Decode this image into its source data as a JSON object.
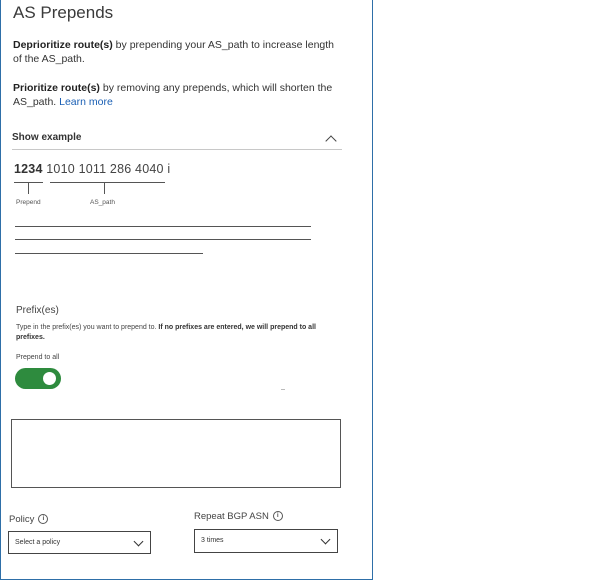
{
  "title": "AS Prepends",
  "deprioritize": {
    "strong": "Deprioritize route(s)",
    "text": " by prepending your AS_path to increase length of the AS_path."
  },
  "prioritize": {
    "strong": "Prioritize route(s)",
    "text": " by removing any prepends, which will shorten the AS_path. ",
    "link": "Learn more"
  },
  "example": {
    "toggle_label": "Show example",
    "prepend_value": "1234",
    "path_value": " 1010 1011 286 4040 i",
    "prepend_label": "Prepend",
    "aspath_label": "AS_path"
  },
  "prefixes": {
    "title": "Prefix(es)",
    "help_text": "Type in the prefix(es) you want to prepend to. ",
    "help_bold": "If no prefixes are entered, we will prepend to all prefixes.",
    "prepend_to_all_label": "Prepend to all",
    "prepend_to_all_on": true,
    "input_value": ""
  },
  "policy": {
    "label": "Policy",
    "selected": "Select a policy"
  },
  "repeat": {
    "label": "Repeat BGP ASN",
    "selected": "3 times"
  }
}
